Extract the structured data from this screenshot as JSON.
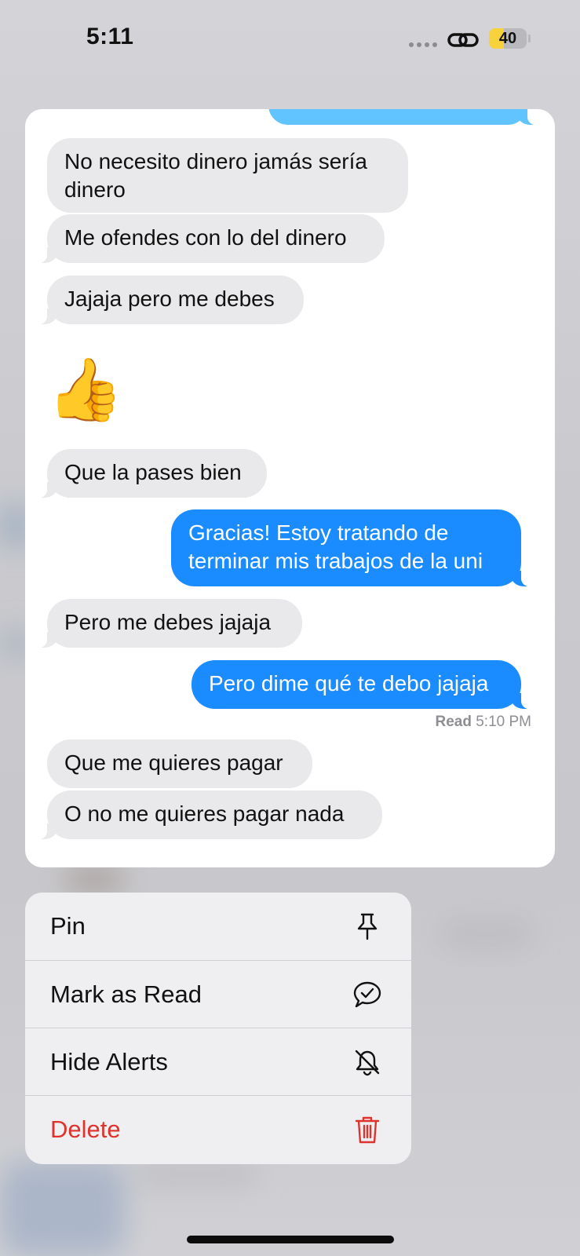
{
  "status_bar": {
    "time": "5:11",
    "battery_level": "40",
    "battery_fraction": 0.4
  },
  "conversation": {
    "messages": [
      {
        "side": "received",
        "text": "No necesito dinero jamás sería dinero"
      },
      {
        "side": "received",
        "text": "Me ofendes con lo del dinero"
      },
      {
        "side": "received",
        "text": "Jajaja pero me debes"
      },
      {
        "side": "received",
        "text": "👍"
      },
      {
        "side": "received",
        "text": "Que la pases bien"
      },
      {
        "side": "sent",
        "text": "Gracias! Estoy tratando de terminar mis trabajos de la uni"
      },
      {
        "side": "received",
        "text": "Pero me debes jajaja"
      },
      {
        "side": "sent",
        "text": "Pero dime qué te debo jajaja"
      },
      {
        "side": "received",
        "text": "Que me quieres pagar"
      },
      {
        "side": "received",
        "text": "O no me quieres pagar nada"
      }
    ],
    "read_receipt": {
      "label": "Read",
      "time": "5:10 PM"
    }
  },
  "context_menu": {
    "items": [
      {
        "label": "Pin",
        "icon": "pin-icon"
      },
      {
        "label": "Mark as Read",
        "icon": "message-check-icon"
      },
      {
        "label": "Hide Alerts",
        "icon": "bell-slash-icon"
      },
      {
        "label": "Delete",
        "icon": "trash-icon",
        "color": "#e0322d"
      }
    ]
  },
  "colors": {
    "sent_bubble": "#1a8cff",
    "received_bubble": "#e9e9eb",
    "destructive": "#e0322d"
  }
}
